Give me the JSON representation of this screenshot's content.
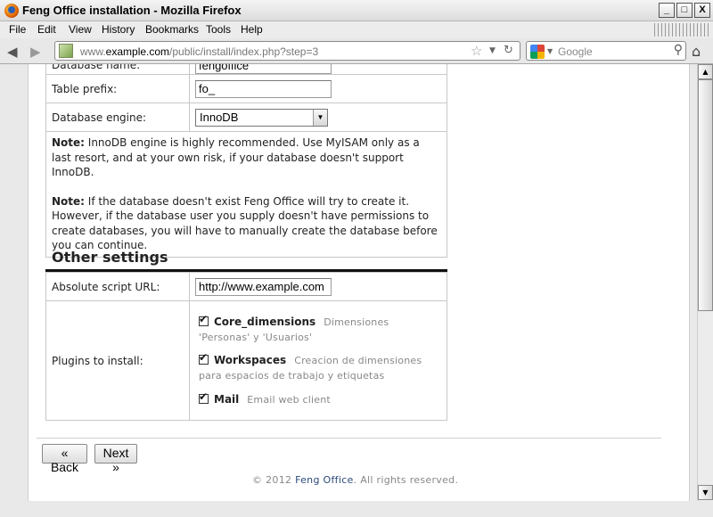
{
  "window": {
    "title": "Feng Office installation - Mozilla Firefox",
    "buttons": [
      "_",
      "□",
      "X"
    ]
  },
  "menu": [
    "File",
    "Edit",
    "View",
    "History",
    "Bookmarks",
    "Tools",
    "Help"
  ],
  "menu_hotkeys": [
    "F",
    "E",
    "V",
    "H",
    "B",
    "T",
    "H"
  ],
  "navbar": {
    "url_prefix": "www.",
    "url_host": "example.com",
    "url_path": "/public/install/index.php?step=3",
    "search_placeholder": "Google"
  },
  "icons": {
    "back": "back-arrow-icon",
    "forward": "forward-arrow-icon",
    "bookmark": "star-icon",
    "reload": "reload-icon",
    "search": "magnifier-icon",
    "home": "home-icon"
  },
  "database": {
    "name_label": "Database name:",
    "name_value": "fengoffice",
    "prefix_label": "Table prefix:",
    "prefix_value": "fo_",
    "engine_label": "Database engine:",
    "engine_value": "InnoDB",
    "note1_bold": "Note:",
    "note1_text": " InnoDB engine is highly recommended. Use MyISAM only as a last resort, and at your own risk, if your database doesn't support InnoDB.",
    "note2_bold": "Note:",
    "note2_text": " If the database doesn't exist Feng Office will try to create it. However, if the database user you supply doesn't have permissions to create databases, you will have to manually create the database before you can continue."
  },
  "other_settings": {
    "title": "Other settings",
    "url_label": "Absolute script URL:",
    "url_value": "http://www.example.com",
    "plugins_label": "Plugins to install:",
    "plugins": [
      {
        "name": "Core_dimensions",
        "desc_line1": "Dimensiones",
        "desc_line2": "'Personas' y 'Usuarios'",
        "checked": true
      },
      {
        "name": "Workspaces",
        "desc_line1": "Creacion de dimensiones",
        "desc_line2": "para espacios de trabajo y etiquetas",
        "checked": true
      },
      {
        "name": "Mail",
        "desc_line1": "Email web client",
        "desc_line2": "",
        "checked": true
      }
    ]
  },
  "buttons": {
    "back": "« Back",
    "next": "Next »"
  },
  "footer": {
    "prefix": "© 2012 ",
    "brand": "Feng Office",
    "suffix": ". All rights reserved."
  }
}
